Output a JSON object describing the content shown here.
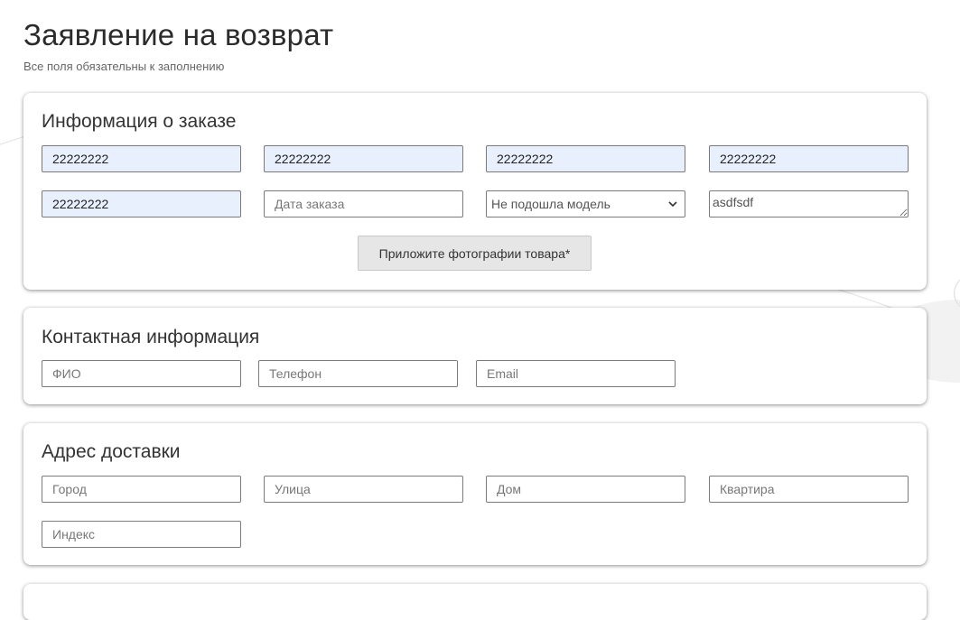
{
  "header": {
    "title": "Заявление на возврат",
    "subtitle": "Все поля обязательны к заполнению"
  },
  "order_section": {
    "title": "Информация о заказе",
    "fields": [
      {
        "value": "22222222"
      },
      {
        "value": "22222222"
      },
      {
        "value": "22222222"
      },
      {
        "value": "22222222"
      },
      {
        "value": "22222222"
      }
    ],
    "order_date": {
      "placeholder": "Дата заказа",
      "value": ""
    },
    "reason_select": {
      "selected": "Не подошла модель"
    },
    "comment": {
      "value": "asdfsdf"
    },
    "upload_button_label": "Приложите фотографии товара*"
  },
  "contact_section": {
    "title": "Контактная информация",
    "fields": [
      {
        "placeholder": "ФИО"
      },
      {
        "placeholder": "Телефон"
      },
      {
        "placeholder": "Email"
      }
    ]
  },
  "address_section": {
    "title": "Адрес доставки",
    "fields": [
      {
        "placeholder": "Город"
      },
      {
        "placeholder": "Улица"
      },
      {
        "placeholder": "Дом"
      },
      {
        "placeholder": "Квартира"
      },
      {
        "placeholder": "Индекс"
      }
    ]
  },
  "colors": {
    "autofill_background": "#e8f0fe",
    "field_border": "#7a7a7a",
    "upload_button_background": "#e6e6e6"
  },
  "icons": {
    "select_arrow": "chevron-down-icon"
  }
}
